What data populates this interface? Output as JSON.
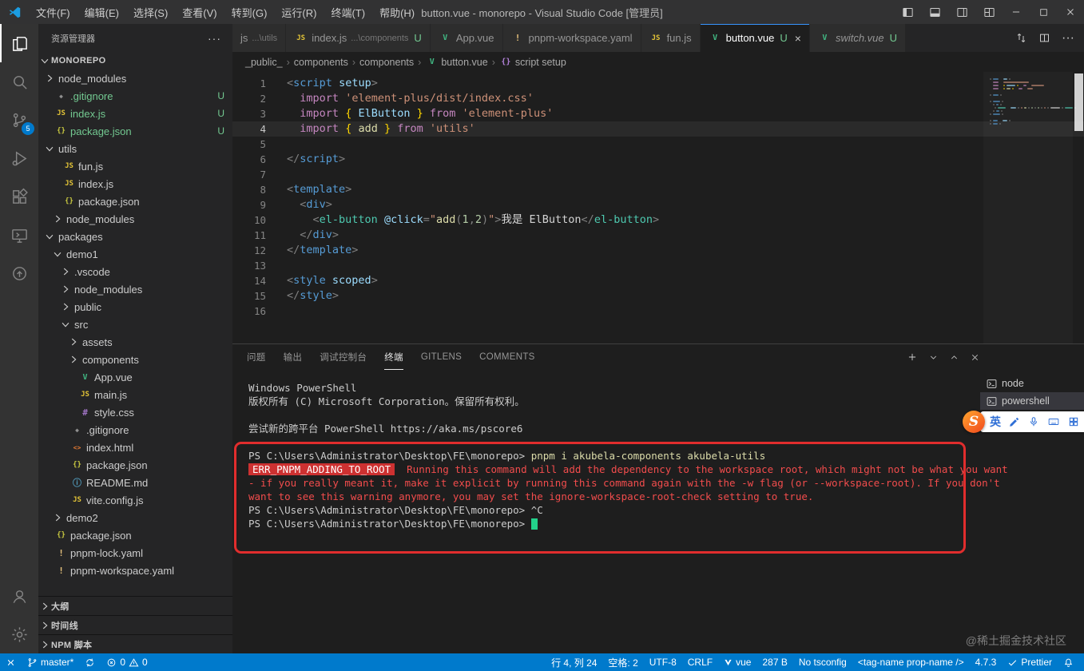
{
  "colors": {
    "accent": "#007acc",
    "annotation": "#e12d2d",
    "untracked": "#73c991",
    "error": "#f14c4c"
  },
  "titlebar": {
    "menus": [
      "文件(F)",
      "编辑(E)",
      "选择(S)",
      "查看(V)",
      "转到(G)",
      "运行(R)",
      "终端(T)",
      "帮助(H)"
    ],
    "title": "button.vue - monorepo - Visual Studio Code [管理员]"
  },
  "activitybar": {
    "scm_badge": "5"
  },
  "sidebar": {
    "title": "资源管理器",
    "root_label": "MONOREPO",
    "tree": [
      {
        "name": "node_modules",
        "folder": true,
        "level": 0
      },
      {
        "name": ".gitignore",
        "icon": "git",
        "level": 0,
        "badge": "U"
      },
      {
        "name": "index.js",
        "icon": "js",
        "level": 0,
        "badge": "U"
      },
      {
        "name": "package.json",
        "icon": "json",
        "level": 0,
        "badge": "U"
      },
      {
        "name": "utils",
        "folder": true,
        "level": 0,
        "expanded": true
      },
      {
        "name": "fun.js",
        "icon": "js",
        "level": 1
      },
      {
        "name": "index.js",
        "icon": "js",
        "level": 1
      },
      {
        "name": "package.json",
        "icon": "json",
        "level": 1
      },
      {
        "name": "node_modules",
        "folder": true,
        "level": 1
      },
      {
        "name": "packages",
        "folder": true,
        "level": 0,
        "expanded": true
      },
      {
        "name": "demo1",
        "folder": true,
        "level": 1,
        "expanded": true
      },
      {
        "name": ".vscode",
        "folder": true,
        "level": 2
      },
      {
        "name": "node_modules",
        "folder": true,
        "level": 2
      },
      {
        "name": "public",
        "folder": true,
        "level": 2
      },
      {
        "name": "src",
        "folder": true,
        "level": 2,
        "expanded": true
      },
      {
        "name": "assets",
        "folder": true,
        "level": 3
      },
      {
        "name": "components",
        "folder": true,
        "level": 3
      },
      {
        "name": "App.vue",
        "icon": "vue",
        "level": 3
      },
      {
        "name": "main.js",
        "icon": "js",
        "level": 3
      },
      {
        "name": "style.css",
        "icon": "css",
        "level": 3
      },
      {
        "name": ".gitignore",
        "icon": "git",
        "level": 2
      },
      {
        "name": "index.html",
        "icon": "html",
        "level": 2
      },
      {
        "name": "package.json",
        "icon": "json",
        "level": 2
      },
      {
        "name": "README.md",
        "icon": "md",
        "level": 2
      },
      {
        "name": "vite.config.js",
        "icon": "js",
        "level": 2
      },
      {
        "name": "demo2",
        "folder": true,
        "level": 1
      },
      {
        "name": "package.json",
        "icon": "json",
        "level": 0
      },
      {
        "name": "pnpm-lock.yaml",
        "icon": "yaml",
        "level": 0
      },
      {
        "name": "pnpm-workspace.yaml",
        "icon": "yaml",
        "level": 0
      }
    ],
    "sections": [
      "大纲",
      "时间线",
      "NPM 脚本"
    ]
  },
  "editor_tabs": {
    "tabs": [
      {
        "label": "js",
        "desc": "...\\utils"
      },
      {
        "label": "index.js",
        "icon": "js",
        "desc": "...\\components",
        "badge": "U"
      },
      {
        "label": "App.vue",
        "icon": "vue"
      },
      {
        "label": "pnpm-workspace.yaml",
        "icon": "warn"
      },
      {
        "label": "fun.js",
        "icon": "js"
      },
      {
        "label": "button.vue",
        "icon": "vue",
        "badge": "U",
        "active": true,
        "close": true
      },
      {
        "label": "switch.vue",
        "icon": "vue",
        "badge": "U",
        "italic": true
      }
    ]
  },
  "breadcrumb": {
    "items": [
      {
        "t": "_public_"
      },
      {
        "t": "components"
      },
      {
        "t": "components"
      },
      {
        "t": "button.vue",
        "icon": "vue"
      },
      {
        "t": "script setup",
        "icon": "sym"
      }
    ]
  },
  "editor": {
    "current_line": 4,
    "lines": [
      [
        [
          "<",
          "p"
        ],
        [
          "script",
          "tag"
        ],
        [
          " ",
          "d"
        ],
        [
          "setup",
          "attr"
        ],
        [
          ">",
          "p"
        ]
      ],
      [
        [
          "  ",
          "d"
        ],
        [
          "import",
          "kw"
        ],
        [
          " ",
          "d"
        ],
        [
          "'element-plus/dist/index.css'",
          "str"
        ]
      ],
      [
        [
          "  ",
          "d"
        ],
        [
          "import",
          "kw"
        ],
        [
          " ",
          "d"
        ],
        [
          "{",
          "br"
        ],
        [
          " ElButton ",
          "id"
        ],
        [
          "}",
          "br"
        ],
        [
          " ",
          "d"
        ],
        [
          "from",
          "kw"
        ],
        [
          " ",
          "d"
        ],
        [
          "'element-plus'",
          "str"
        ]
      ],
      [
        [
          "  ",
          "d"
        ],
        [
          "import",
          "kw"
        ],
        [
          " ",
          "d"
        ],
        [
          "{",
          "br"
        ],
        [
          " add ",
          "fn"
        ],
        [
          "}",
          "br"
        ],
        [
          " ",
          "d"
        ],
        [
          "from",
          "kw"
        ],
        [
          " ",
          "d"
        ],
        [
          "'utils'",
          "str"
        ]
      ],
      [],
      [
        [
          "</",
          "p"
        ],
        [
          "script",
          "tag"
        ],
        [
          ">",
          "p"
        ]
      ],
      [],
      [
        [
          "<",
          "p"
        ],
        [
          "template",
          "tag"
        ],
        [
          ">",
          "p"
        ]
      ],
      [
        [
          "  ",
          "d"
        ],
        [
          "<",
          "p"
        ],
        [
          "div",
          "tag"
        ],
        [
          ">",
          "p"
        ]
      ],
      [
        [
          "    ",
          "d"
        ],
        [
          "<",
          "p"
        ],
        [
          "el-button",
          "cmp"
        ],
        [
          " ",
          "d"
        ],
        [
          "@click",
          "attr"
        ],
        [
          "=",
          "p"
        ],
        [
          "\"",
          "str"
        ],
        [
          "add",
          "fn"
        ],
        [
          "(",
          "p"
        ],
        [
          "1",
          "num"
        ],
        [
          ",",
          "p"
        ],
        [
          "2",
          "num"
        ],
        [
          ")",
          "p"
        ],
        [
          "\"",
          "str"
        ],
        [
          ">",
          "p"
        ],
        [
          "我是 ElButton",
          "txt"
        ],
        [
          "</",
          "p"
        ],
        [
          "el-button",
          "cmp"
        ],
        [
          ">",
          "p"
        ]
      ],
      [
        [
          "  ",
          "d"
        ],
        [
          "</",
          "p"
        ],
        [
          "div",
          "tag"
        ],
        [
          ">",
          "p"
        ]
      ],
      [
        [
          "</",
          "p"
        ],
        [
          "template",
          "tag"
        ],
        [
          ">",
          "p"
        ]
      ],
      [],
      [
        [
          "<",
          "p"
        ],
        [
          "style",
          "tag"
        ],
        [
          " ",
          "d"
        ],
        [
          "scoped",
          "attr"
        ],
        [
          ">",
          "p"
        ]
      ],
      [
        [
          "</",
          "p"
        ],
        [
          "style",
          "tag"
        ],
        [
          ">",
          "p"
        ]
      ],
      []
    ]
  },
  "panel": {
    "tabs": [
      {
        "label": "问题"
      },
      {
        "label": "输出"
      },
      {
        "label": "调试控制台"
      },
      {
        "label": "终端",
        "active": true
      },
      {
        "label": "GITLENS"
      },
      {
        "label": "COMMENTS"
      }
    ],
    "terminal": {
      "lines": [
        [
          [
            "Windows PowerShell",
            "def"
          ]
        ],
        [
          [
            "版权所有 (C) Microsoft Corporation。保留所有权利。",
            "def"
          ]
        ],
        [],
        [
          [
            "尝试新的跨平台 PowerShell https://aka.ms/pscore6",
            "def"
          ]
        ],
        [],
        [
          [
            "PS C:\\Users\\Administrator\\Desktop\\FE\\monorepo> ",
            "def"
          ],
          [
            "pnpm i akubela-components akubela-utils",
            "cmd"
          ]
        ],
        [
          [
            "ERR_PNPM_ADDING_TO_ROOT",
            "errbadge"
          ],
          [
            "  Running this command will add the dependency to the workspace root, which might not be what you want",
            "err"
          ]
        ],
        [
          [
            "- if you really meant it, make it explicit by running this command again with the -w flag (or --workspace-root). If you don't",
            "err"
          ]
        ],
        [
          [
            "want to see this warning anymore, you may set the ignore-workspace-root-check setting to true.",
            "err"
          ]
        ],
        [
          [
            "PS C:\\Users\\Administrator\\Desktop\\FE\\monorepo> ",
            "def"
          ],
          [
            "^C",
            "def"
          ]
        ],
        [
          [
            "PS C:\\Users\\Administrator\\Desktop\\FE\\monorepo> ",
            "def"
          ],
          [
            "",
            "cursor"
          ]
        ]
      ]
    },
    "list": [
      {
        "label": "node"
      },
      {
        "label": "powershell",
        "selected": true
      }
    ]
  },
  "statusbar": {
    "branch": "master*",
    "errors": "0",
    "warnings": "0",
    "line_col": "行 4, 列 24",
    "indent": "空格: 2",
    "encoding": "UTF-8",
    "eol": "CRLF",
    "language": "vue",
    "file_size": "287 B",
    "tsconfig": "No tsconfig",
    "tag_hint": "<tag-name prop-name />",
    "version": "4.7.3",
    "formatter": "Prettier"
  },
  "ime": {
    "mode": "英"
  },
  "watermark": "@稀土掘金技术社区"
}
